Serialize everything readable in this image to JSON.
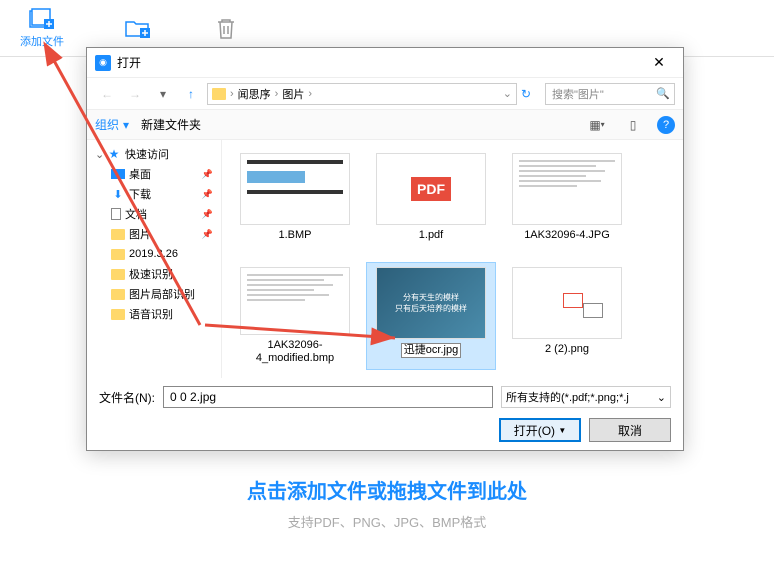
{
  "bg": {
    "add_file": "添加文件",
    "drop_title": "点击添加文件或拖拽文件到此处",
    "drop_sub": "支持PDF、PNG、JPG、BMP格式"
  },
  "dialog": {
    "title": "打开",
    "nav": {
      "path_user": "闻思序",
      "path_folder": "图片",
      "search_placeholder": "搜索\"图片\""
    },
    "cmd": {
      "organize": "组织",
      "new_folder": "新建文件夹"
    },
    "tree": {
      "quick": "快速访问",
      "desktop": "桌面",
      "downloads": "下载",
      "documents": "文档",
      "pictures": "图片",
      "f1": "2019.3.26",
      "f2": "极速识别",
      "f3": "图片局部识别",
      "f4": "语音识别"
    },
    "files": [
      {
        "name": "1.BMP",
        "type": "doc"
      },
      {
        "name": "1.pdf",
        "type": "pdf"
      },
      {
        "name": "1AK32096-4.JPG",
        "type": "text"
      },
      {
        "name": "1AK32096-4_modified.bmp",
        "type": "text"
      },
      {
        "name": "迅捷ocr.jpg",
        "type": "image",
        "selected": true
      },
      {
        "name": "2 (2).png",
        "type": "diagram"
      }
    ],
    "footer": {
      "filename_label": "文件名(N):",
      "filename_value": "0 0 2.jpg",
      "type_filter": "所有支持的(*.pdf;*.png;*.j",
      "open": "打开(O)",
      "cancel": "取消"
    }
  }
}
